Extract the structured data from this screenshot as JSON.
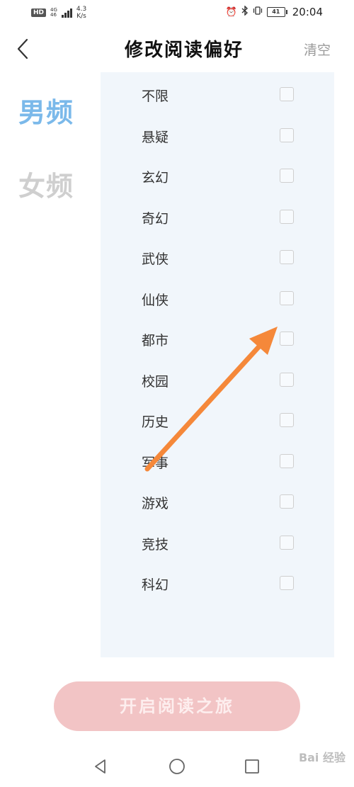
{
  "status_bar": {
    "hd": "HD",
    "net_top": "4G",
    "net_bottom": "46",
    "speed_value": "4.3",
    "speed_unit": "K/s",
    "battery": "41",
    "time": "20:04"
  },
  "header": {
    "title": "修改阅读偏好",
    "clear_label": "清空"
  },
  "tabs": {
    "male": "男频",
    "female": "女频",
    "selected": "male"
  },
  "genres": [
    {
      "label": "不限",
      "checked": false
    },
    {
      "label": "悬疑",
      "checked": false
    },
    {
      "label": "玄幻",
      "checked": false
    },
    {
      "label": "奇幻",
      "checked": false
    },
    {
      "label": "武侠",
      "checked": false
    },
    {
      "label": "仙侠",
      "checked": false
    },
    {
      "label": "都市",
      "checked": false
    },
    {
      "label": "校园",
      "checked": false
    },
    {
      "label": "历史",
      "checked": false
    },
    {
      "label": "军事",
      "checked": false
    },
    {
      "label": "游戏",
      "checked": false
    },
    {
      "label": "竞技",
      "checked": false
    },
    {
      "label": "科幻",
      "checked": false
    }
  ],
  "start_button": "开启阅读之旅",
  "watermark": "Bai 经验",
  "colors": {
    "accent_blue": "#7bb9ea",
    "panel_bg": "#f1f6fb",
    "button_bg": "#f2c4c5",
    "annotation_arrow": "#f5883a"
  }
}
